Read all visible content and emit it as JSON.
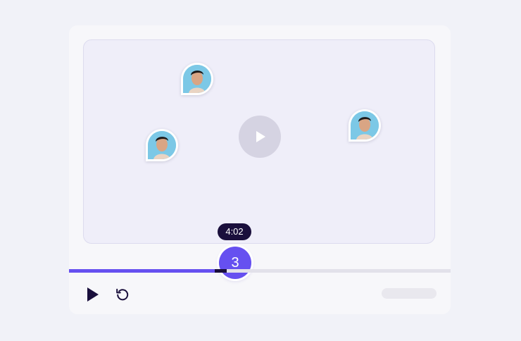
{
  "player": {
    "current_time": "4:02",
    "comment_count": "3",
    "progress": 0.383
  },
  "icons": {
    "center_play": "play-icon",
    "control_play": "play-icon",
    "replay": "replay-icon",
    "avatar": "user-avatar"
  },
  "colors": {
    "accent": "#6650f0",
    "dark": "#1a0f3c",
    "video_bg": "#efeef9"
  }
}
